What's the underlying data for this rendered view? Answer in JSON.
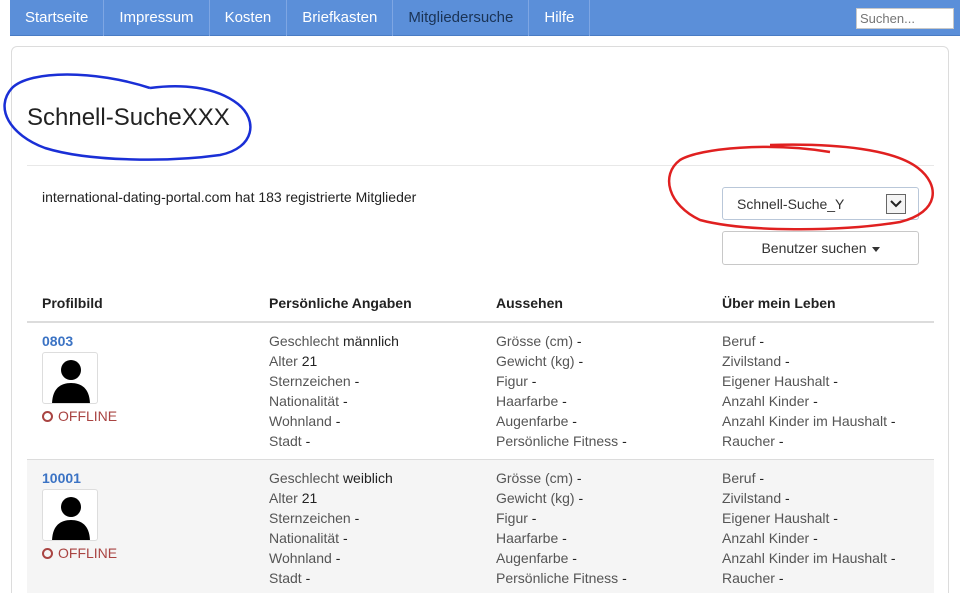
{
  "nav": {
    "items": [
      "Startseite",
      "Impressum",
      "Kosten",
      "Briefkasten",
      "Mitgliedersuche",
      "Hilfe"
    ],
    "search_placeholder": "Suchen..."
  },
  "page": {
    "title": "Schnell-SucheXXX",
    "member_count": "international-dating-portal.com hat 183 registrierte Mitglieder",
    "select_value": "Schnell-Suche_Y",
    "user_search_label": "Benutzer suchen"
  },
  "table": {
    "headers": [
      "Profilbild",
      "Persönliche Angaben",
      "Aussehen",
      "Über mein Leben"
    ],
    "rows": [
      {
        "id": "0803",
        "status": "OFFLINE",
        "personal": [
          {
            "label": "Geschlecht",
            "value": "männlich"
          },
          {
            "label": "Alter",
            "value": "21"
          },
          {
            "label": "Sternzeichen",
            "value": "-"
          },
          {
            "label": "Nationalität",
            "value": "-"
          },
          {
            "label": "Wohnland",
            "value": "-"
          },
          {
            "label": "Stadt",
            "value": "-"
          }
        ],
        "looks": [
          {
            "label": "Grösse (cm)",
            "value": "-"
          },
          {
            "label": "Gewicht (kg)",
            "value": "-"
          },
          {
            "label": "Figur",
            "value": "-"
          },
          {
            "label": "Haarfarbe",
            "value": "-"
          },
          {
            "label": "Augenfarbe",
            "value": "-"
          },
          {
            "label": "Persönliche Fitness",
            "value": "-"
          }
        ],
        "life": [
          {
            "label": "Beruf",
            "value": "-"
          },
          {
            "label": "Zivilstand",
            "value": "-"
          },
          {
            "label": "Eigener Haushalt",
            "value": "-"
          },
          {
            "label": "Anzahl Kinder",
            "value": "-"
          },
          {
            "label": "Anzahl Kinder im Haushalt",
            "value": "-"
          },
          {
            "label": "Raucher",
            "value": "-"
          }
        ]
      },
      {
        "id": "10001",
        "status": "OFFLINE",
        "personal": [
          {
            "label": "Geschlecht",
            "value": "weiblich"
          },
          {
            "label": "Alter",
            "value": "21"
          },
          {
            "label": "Sternzeichen",
            "value": "-"
          },
          {
            "label": "Nationalität",
            "value": "-"
          },
          {
            "label": "Wohnland",
            "value": "-"
          },
          {
            "label": "Stadt",
            "value": "-"
          }
        ],
        "looks": [
          {
            "label": "Grösse (cm)",
            "value": "-"
          },
          {
            "label": "Gewicht (kg)",
            "value": "-"
          },
          {
            "label": "Figur",
            "value": "-"
          },
          {
            "label": "Haarfarbe",
            "value": "-"
          },
          {
            "label": "Augenfarbe",
            "value": "-"
          },
          {
            "label": "Persönliche Fitness",
            "value": "-"
          }
        ],
        "life": [
          {
            "label": "Beruf",
            "value": "-"
          },
          {
            "label": "Zivilstand",
            "value": "-"
          },
          {
            "label": "Eigener Haushalt",
            "value": "-"
          },
          {
            "label": "Anzahl Kinder",
            "value": "-"
          },
          {
            "label": "Anzahl Kinder im Haushalt",
            "value": "-"
          },
          {
            "label": "Raucher",
            "value": "-"
          }
        ]
      }
    ]
  },
  "colors": {
    "nav_bg": "#5b8fd9",
    "link": "#3b73c4",
    "offline": "#a94442",
    "annotation_blue": "#1a2fd6",
    "annotation_red": "#e02020"
  }
}
